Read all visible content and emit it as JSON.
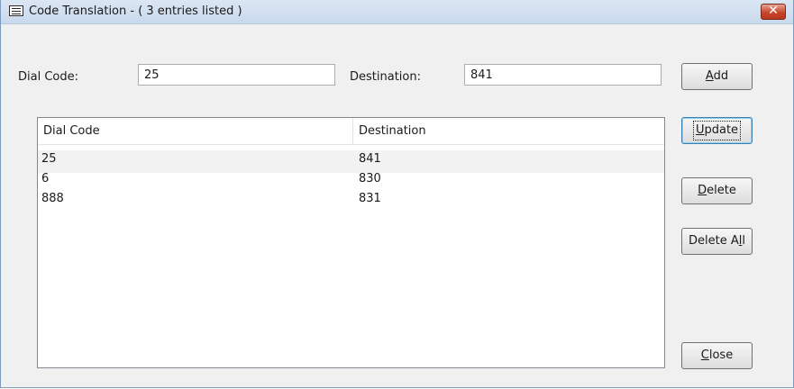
{
  "window": {
    "title": "Code Translation - ( 3 entries listed )",
    "close_glyph": "✕"
  },
  "form": {
    "dial_code_label": "Dial Code:",
    "dial_code_value": "25",
    "destination_label": "Destination:",
    "destination_value": "841"
  },
  "table": {
    "headers": [
      "Dial Code",
      "Destination"
    ],
    "rows": [
      {
        "dial_code": "25",
        "destination": "841"
      },
      {
        "dial_code": "6",
        "destination": "830"
      },
      {
        "dial_code": "888",
        "destination": "831"
      }
    ]
  },
  "buttons": {
    "add": {
      "mnemonic": "A",
      "rest": "dd"
    },
    "update": {
      "mnemonic": "U",
      "rest": "pdate"
    },
    "delete": {
      "mnemonic": "D",
      "rest": "elete"
    },
    "delete_all": {
      "prefix": "Delete A",
      "mnemonic": "l",
      "rest": "l"
    },
    "close": {
      "mnemonic": "C",
      "rest": "lose"
    }
  },
  "icons": {
    "title_icon": "window-menu-icon",
    "close_icon": "close-icon"
  },
  "colors": {
    "close_button": "#c7472c",
    "selected_row": "#f2f2f2",
    "focus_border": "#3c7fb1"
  }
}
